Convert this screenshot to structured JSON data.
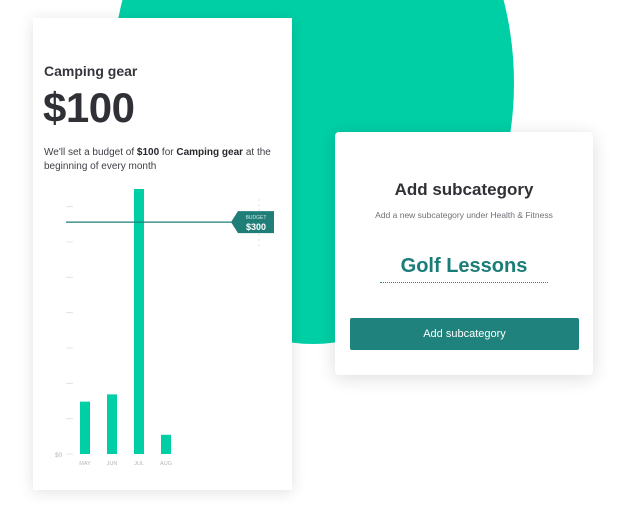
{
  "budget_card": {
    "category": "Camping gear",
    "amount": "$100",
    "description_prefix": "We'll set a budget of ",
    "description_amount": "$100",
    "description_mid": " for ",
    "description_category": "Camping gear",
    "description_suffix": " at the beginning of every month"
  },
  "chart_data": {
    "type": "bar",
    "categories": [
      "MAY",
      "JUN",
      "JUL",
      "AUG"
    ],
    "values": [
      158,
      180,
      800,
      58
    ],
    "ylim": [
      0,
      800
    ],
    "y_min_label": "$0",
    "budget_marker": {
      "label": "BUDGET",
      "value_label": "$300",
      "value": 700
    },
    "bar_color": "#00cfa6",
    "marker_color": "#1f7e78"
  },
  "modal": {
    "title": "Add subcategory",
    "subtitle": "Add a new subcategory under Health & Fitness",
    "input_value": "Golf Lessons",
    "button_label": "Add subcategory"
  },
  "colors": {
    "accent": "#00cfa6",
    "primary": "#1f827c"
  }
}
